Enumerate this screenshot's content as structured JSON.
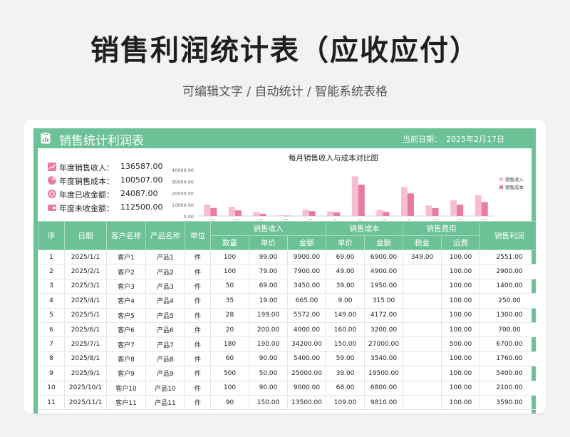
{
  "page": {
    "title": "销售利润统计表（应收应付）",
    "subtitle": "可编辑文字 / 自动统计 / 智能系统表格"
  },
  "sheet": {
    "title": "销售统计利润表",
    "date_label": "当前日期：",
    "date_value": "2025年2月17日"
  },
  "summary": [
    {
      "label": "年度销售收入：",
      "value": "136587.00",
      "icon": "revenue-icon"
    },
    {
      "label": "年度销售成本：",
      "value": "100507.00",
      "icon": "pie-icon"
    },
    {
      "label": "年度已收金额：",
      "value": "24087.00",
      "icon": "coin-icon"
    },
    {
      "label": "年度未收金额：",
      "value": "112500.00",
      "icon": "wallet-icon"
    }
  ],
  "colors": {
    "green": "#6cc197",
    "income": "#f6bfcf",
    "cost": "#e87ba2"
  },
  "chart_data": {
    "type": "bar",
    "title": "每月销售收入与成本对比图",
    "categories": [
      "1月",
      "2月",
      "3月",
      "4月",
      "5月",
      "6月",
      "7月",
      "8月",
      "9月",
      "10月",
      "11月",
      "12月"
    ],
    "series": [
      {
        "name": "销售收入",
        "values": [
          9900,
          7900,
          3450,
          665,
          5572,
          4000,
          34200,
          5400,
          25000,
          9000,
          13500,
          18000
        ]
      },
      {
        "name": "销售成本",
        "values": [
          6900,
          4900,
          1950,
          315,
          4172,
          3200,
          27000,
          3540,
          19500,
          6800,
          9810,
          12000
        ]
      }
    ],
    "y_ticks": [
      "40000.00",
      "30000.00",
      "20000.00",
      "10000.00",
      "0.00"
    ],
    "ylim": [
      0,
      40000
    ],
    "legend": "right"
  },
  "table": {
    "headers": {
      "seq": "序",
      "date": "日期",
      "customer": "客户名称",
      "product": "产品名称",
      "unit": "单位",
      "sales": "销售收入",
      "cost": "销售成本",
      "fee": "销售费用",
      "profit": "销售利润",
      "qty": "数量",
      "price": "单价",
      "amount": "金额",
      "cost_price": "单价",
      "cost_amount": "金额",
      "tax": "税金",
      "freight": "运费"
    },
    "rows": [
      [
        "1",
        "2025/1/1",
        "客户1",
        "产品1",
        "件",
        "100",
        "99.00",
        "9900.00",
        "69.00",
        "6900.00",
        "349.00",
        "100.00",
        "2551.00"
      ],
      [
        "2",
        "2025/2/1",
        "客户2",
        "产品2",
        "件",
        "100",
        "79.00",
        "7900.00",
        "49.00",
        "4900.00",
        "",
        "100.00",
        "2900.00"
      ],
      [
        "3",
        "2025/3/1",
        "客户3",
        "产品3",
        "件",
        "50",
        "69.00",
        "3450.00",
        "39.00",
        "1950.00",
        "",
        "100.00",
        "1400.00"
      ],
      [
        "4",
        "2025/4/1",
        "客户4",
        "产品4",
        "件",
        "35",
        "19.00",
        "665.00",
        "9.00",
        "315.00",
        "",
        "100.00",
        "250.00"
      ],
      [
        "5",
        "2025/5/1",
        "客户5",
        "产品5",
        "件",
        "28",
        "199.00",
        "5572.00",
        "149.00",
        "4172.00",
        "",
        "100.00",
        "1300.00"
      ],
      [
        "6",
        "2025/6/1",
        "客户6",
        "产品6",
        "件",
        "20",
        "200.00",
        "4000.00",
        "160.00",
        "3200.00",
        "",
        "100.00",
        "700.00"
      ],
      [
        "7",
        "2025/7/1",
        "客户7",
        "产品7",
        "件",
        "180",
        "190.00",
        "34200.00",
        "150.00",
        "27000.00",
        "",
        "500.00",
        "6700.00"
      ],
      [
        "8",
        "2025/8/1",
        "客户8",
        "产品8",
        "件",
        "60",
        "90.00",
        "5400.00",
        "59.00",
        "3540.00",
        "",
        "100.00",
        "1760.00"
      ],
      [
        "9",
        "2025/9/1",
        "客户9",
        "产品9",
        "件",
        "500",
        "50.00",
        "25000.00",
        "39.00",
        "19500.00",
        "",
        "100.00",
        "5400.00"
      ],
      [
        "10",
        "2025/10/1",
        "客户10",
        "产品10",
        "件",
        "100",
        "90.00",
        "9000.00",
        "68.00",
        "6800.00",
        "",
        "100.00",
        "2100.00"
      ],
      [
        "11",
        "2025/11/1",
        "客户11",
        "产品11",
        "件",
        "90",
        "150.00",
        "13500.00",
        "109.00",
        "9810.00",
        "",
        "100.00",
        "3590.00"
      ]
    ]
  }
}
